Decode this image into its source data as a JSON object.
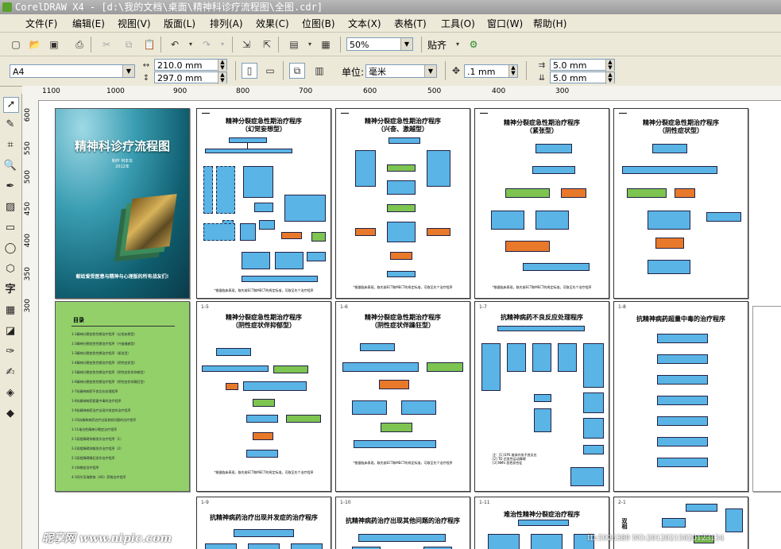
{
  "window": {
    "title": "CorelDRAW X4 - [d:\\我的文档\\桌面\\精神科诊疗流程图\\全图.cdr]"
  },
  "menu": [
    "文件(F)",
    "编辑(E)",
    "视图(V)",
    "版面(L)",
    "排列(A)",
    "效果(C)",
    "位图(B)",
    "文本(X)",
    "表格(T)",
    "工具(O)",
    "窗口(W)",
    "帮助(H)"
  ],
  "toolbar": {
    "zoom_value": "50%",
    "snap_label": "贴齐"
  },
  "property_bar": {
    "paper_size": "A4",
    "width": "210.0 mm",
    "height": "297.0 mm",
    "units_label": "单位:",
    "units_value": "毫米",
    "nudge": ".1 mm",
    "dup_x": "5.0 mm",
    "dup_y": "5.0 mm"
  },
  "ruler": {
    "h_ticks": [
      "1100",
      "1000",
      "900",
      "800",
      "700",
      "600",
      "500",
      "400",
      "300"
    ],
    "v_ticks": [
      "600",
      "550",
      "500",
      "450",
      "400",
      "350",
      "300"
    ]
  },
  "cover": {
    "title": "精神科诊疗流程图",
    "author": "制作  何本东",
    "date": "2012年",
    "motto": "献给爱受医患与精神与心理版的所有战友们!"
  },
  "toc": {
    "heading": "目录",
    "items": [
      "1-1精神分裂症急性期治疗程序（幻觉妄想型）",
      "1-2精神分裂症急性期治疗程序（兴奋激越型）",
      "1-3精神分裂症急性期治疗程序（紧张型）",
      "1-4精神分裂症急性期治疗程序（阴性症状型）",
      "1-5精神分裂症急性期治疗程序（阴性症状伴抑郁型）",
      "1-6精神分裂症急性期治疗程序（阴性症状伴躁狂型）",
      "1-7抗精神病药不良反应处理程序",
      "1-8抗精神病药超量中毒的治疗程序",
      "1-9抗精神病药治疗出现并发症的治疗程序",
      "1-10抗精神病药治疗出现其他问题的治疗程序",
      "1-11难治性精神分裂症治疗程序",
      "2-1双相障碍抑郁发作治疗程序（1）",
      "2-2双相障碍抑郁发作治疗程序（2）",
      "2-3双相障碍躁狂发作治疗程序",
      "3-1抑郁症治疗程序",
      "4-1阿尔茨海默病（AD）药物治疗程序"
    ]
  },
  "pages": [
    {
      "num": "",
      "title": "精神分裂症急性期治疗程序\n（幻觉妄想型）",
      "foot": "*根据临床表现，取先前ECT和MECT的肯定标准，可取至先个治疗程序"
    },
    {
      "num": "",
      "title": "精神分裂症急性期治疗程序\n（兴奋、激越型）",
      "foot": "*根据临床表现，取先前ECT和MECT的肯定标准，可取至先个治疗程序"
    },
    {
      "num": "",
      "title": "精神分裂症急性期治疗程序\n（紧张型）",
      "foot": "*根据临床表现，取先前ECT和MECT的肯定标准，可取至先个治疗程序"
    },
    {
      "num": "",
      "title": "精神分裂症急性期治疗程序\n（阴性症状型）",
      "foot": ""
    },
    {
      "num": "1-5",
      "title": "精神分裂症急性期治疗程序\n（阴性症状伴抑郁型）",
      "foot": "*根据临床表现，取先前ECT和MECT的肯定标准，可取至先个治疗程序"
    },
    {
      "num": "1-6",
      "title": "精神分裂症急性期治疗程序\n（阴性症状伴躁狂型）",
      "foot": "*根据临床表现，取先前ECT和MECT的肯定标准，可取至先个治疗程序"
    },
    {
      "num": "1-7",
      "title": "抗精神病药不良反应处理程序",
      "foot": ""
    },
    {
      "num": "1-8",
      "title": "抗精神病药超量中毒的治疗程序",
      "foot": ""
    },
    {
      "num": "1-9",
      "title": "抗精神病药治疗出现并发症的治疗程序",
      "foot": ""
    },
    {
      "num": "1-10",
      "title": "抗精神病药治疗出现其他问题的治疗程序",
      "foot": ""
    },
    {
      "num": "1-11",
      "title": "难治性精神分裂症治疗程序",
      "foot": ""
    },
    {
      "num": "2-1",
      "title": "双相",
      "foot": ""
    }
  ],
  "watermark": {
    "left": "昵享网 www.nipic.com",
    "right": "ID:5926389 NO:20120215020123134"
  },
  "colors": {
    "box_blue": "#5ab4e6",
    "box_green": "#7dc451",
    "box_orange": "#e8792a",
    "toc_green": "#93d06a"
  }
}
